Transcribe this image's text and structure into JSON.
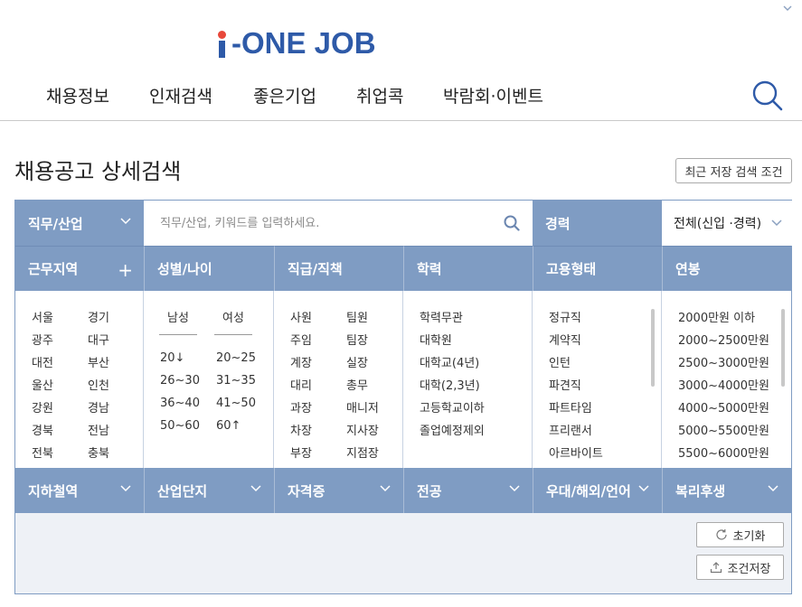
{
  "logo": {
    "text": "i-ONE JOB"
  },
  "nav": {
    "items": [
      "채용정보",
      "인재검색",
      "좋은기업",
      "취업콕",
      "박람회·이벤트"
    ]
  },
  "page": {
    "title": "채용공고 상세검색",
    "saved_conditions_label": "최근 저장 검색 조건"
  },
  "filters": {
    "job": {
      "label": "직무/산업"
    },
    "keyword": {
      "placeholder": "직무/산업, 키워드를 입력하세요."
    },
    "career": {
      "label": "경력",
      "selected": "전체(신입 ·경력)"
    },
    "region": {
      "label": "근무지역",
      "options": [
        "서울",
        "경기",
        "광주",
        "대구",
        "대전",
        "부산",
        "울산",
        "인천",
        "강원",
        "경남",
        "경북",
        "전남",
        "전북",
        "충북"
      ]
    },
    "gender_age": {
      "label": "성별/나이",
      "male": "남성",
      "female": "여성",
      "ages": [
        "20↓",
        "20~25",
        "26~30",
        "31~35",
        "36~40",
        "41~50",
        "50~60",
        "60↑"
      ]
    },
    "position": {
      "label": "직급/직책",
      "options": [
        "사원",
        "팀원",
        "주임",
        "팀장",
        "계장",
        "실장",
        "대리",
        "총무",
        "과장",
        "매니저",
        "차장",
        "지사장",
        "부장",
        "지점장"
      ]
    },
    "education": {
      "label": "학력",
      "options": [
        "학력무관",
        "대학원",
        "대학교(4년)",
        "대학(2,3년)",
        "고등학교이하",
        "졸업예정제외"
      ]
    },
    "employment": {
      "label": "고용형태",
      "options": [
        "정규직",
        "계약직",
        "인턴",
        "파견직",
        "파트타임",
        "프리랜서",
        "아르바이트"
      ]
    },
    "salary": {
      "label": "연봉",
      "options": [
        "2000만원 이하",
        "2000~2500만원",
        "2500~3000만원",
        "3000~4000만원",
        "4000~5000만원",
        "5000~5500만원",
        "5500~6000만원"
      ]
    },
    "bottom_row": [
      "지하철역",
      "산업단지",
      "자격증",
      "전공",
      "우대/해외/언어",
      "복리후생"
    ]
  },
  "actions": {
    "reset_label": "초기화",
    "save_label": "조건저장"
  },
  "colors": {
    "brand_blue": "#2e5aa8",
    "logo_dot": "#e8483b",
    "header_bg": "#7f9cc3",
    "panel_bg": "#eef1f6"
  }
}
